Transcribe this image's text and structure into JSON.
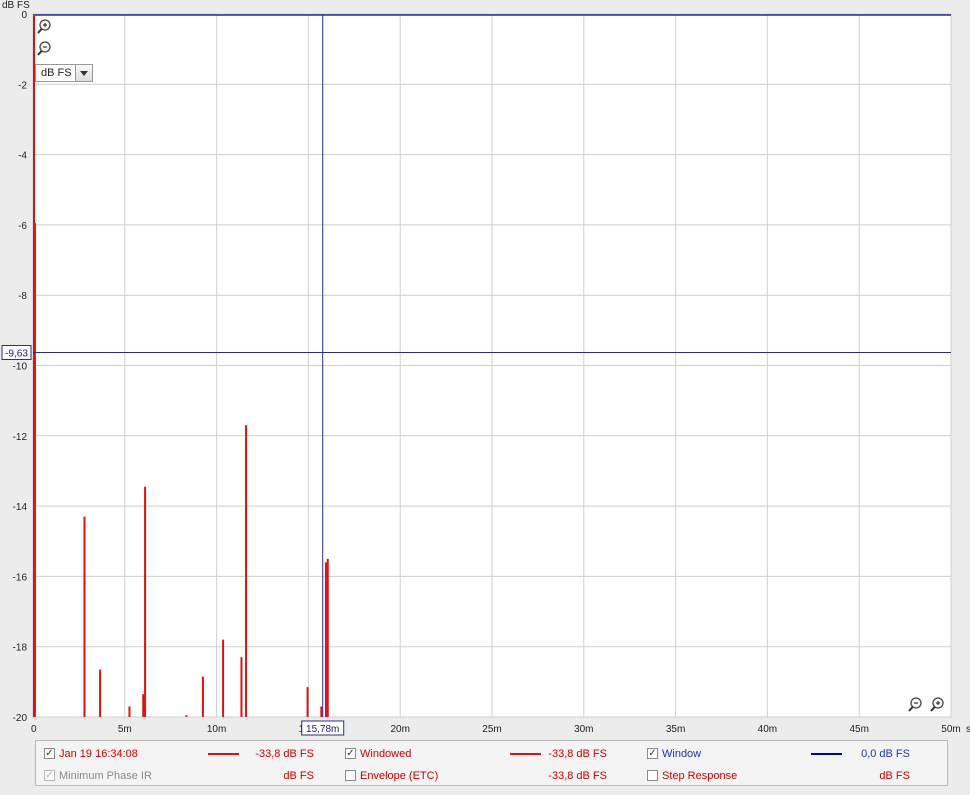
{
  "chart_data": {
    "type": "line",
    "ylabel": "dB FS",
    "xlabel": "",
    "x_unit_label": "s",
    "xlim": [
      0,
      50
    ],
    "ylim": [
      -20,
      0
    ],
    "x_ticks": [
      0,
      5,
      10,
      15,
      20,
      25,
      30,
      35,
      40,
      45,
      50
    ],
    "x_tick_labels": [
      "0",
      "5m",
      "10m",
      "15m",
      "20m",
      "25m",
      "30m",
      "35m",
      "40m",
      "45m",
      "50m"
    ],
    "y_ticks": [
      0,
      -2,
      -4,
      -6,
      -8,
      -10,
      -12,
      -14,
      -16,
      -18,
      -20
    ],
    "y_tick_labels": [
      "0",
      "-2",
      "-4",
      "-6",
      "-8",
      "-10",
      "-12",
      "-14",
      "-16",
      "-18",
      "-20"
    ],
    "grid": true,
    "cursor": {
      "x": 15.78,
      "y": -9.63,
      "x_label": "15,78m",
      "y_label": "-9,63"
    },
    "series": [
      {
        "name": "Jan 19 16:34:08",
        "color": "#dd1111",
        "spikes": [
          [
            0.0,
            -5.9
          ],
          [
            0.05,
            -5.95
          ],
          [
            2.75,
            -14.3
          ],
          [
            3.6,
            -18.65
          ],
          [
            5.2,
            -19.7
          ],
          [
            5.95,
            -19.35
          ],
          [
            6.05,
            -13.45
          ],
          [
            8.3,
            -19.95
          ],
          [
            9.2,
            -18.85
          ],
          [
            10.3,
            -17.8
          ],
          [
            11.3,
            -18.3
          ],
          [
            11.55,
            -11.7
          ],
          [
            14.9,
            -19.15
          ],
          [
            15.65,
            -19.7
          ],
          [
            15.9,
            -15.6
          ],
          [
            16.0,
            -15.5
          ]
        ]
      },
      {
        "name": "Window",
        "color": "#00008b",
        "level": 0
      }
    ],
    "legend_position": "bottom"
  },
  "units_select": {
    "value": "dB FS"
  },
  "legend": [
    {
      "label": "Jan 19 16:34:08",
      "checked": true,
      "value": "-33,8 dB FS",
      "color": "#dd1111",
      "label_color": "#cc0000",
      "line": true
    },
    {
      "label": "Windowed",
      "checked": true,
      "value": "-33,8 dB FS",
      "color": "#dd1111",
      "label_color": "#cc0000",
      "line": true
    },
    {
      "label": "Window",
      "checked": true,
      "value": "0,0 dB FS",
      "color": "#0000aa",
      "label_color": "#2233aa",
      "line": true
    },
    {
      "label": "Minimum Phase IR",
      "checked": true,
      "disabled": true,
      "value": "dB FS",
      "color": "",
      "label_color": "#8a8a8a",
      "line": false
    },
    {
      "label": "Envelope (ETC)",
      "checked": false,
      "value": "-33,8 dB FS",
      "color": "",
      "label_color": "#cc0000",
      "line": false
    },
    {
      "label": "Step Response",
      "checked": false,
      "value": "dB FS",
      "color": "",
      "label_color": "#cc0000",
      "line": false
    }
  ]
}
